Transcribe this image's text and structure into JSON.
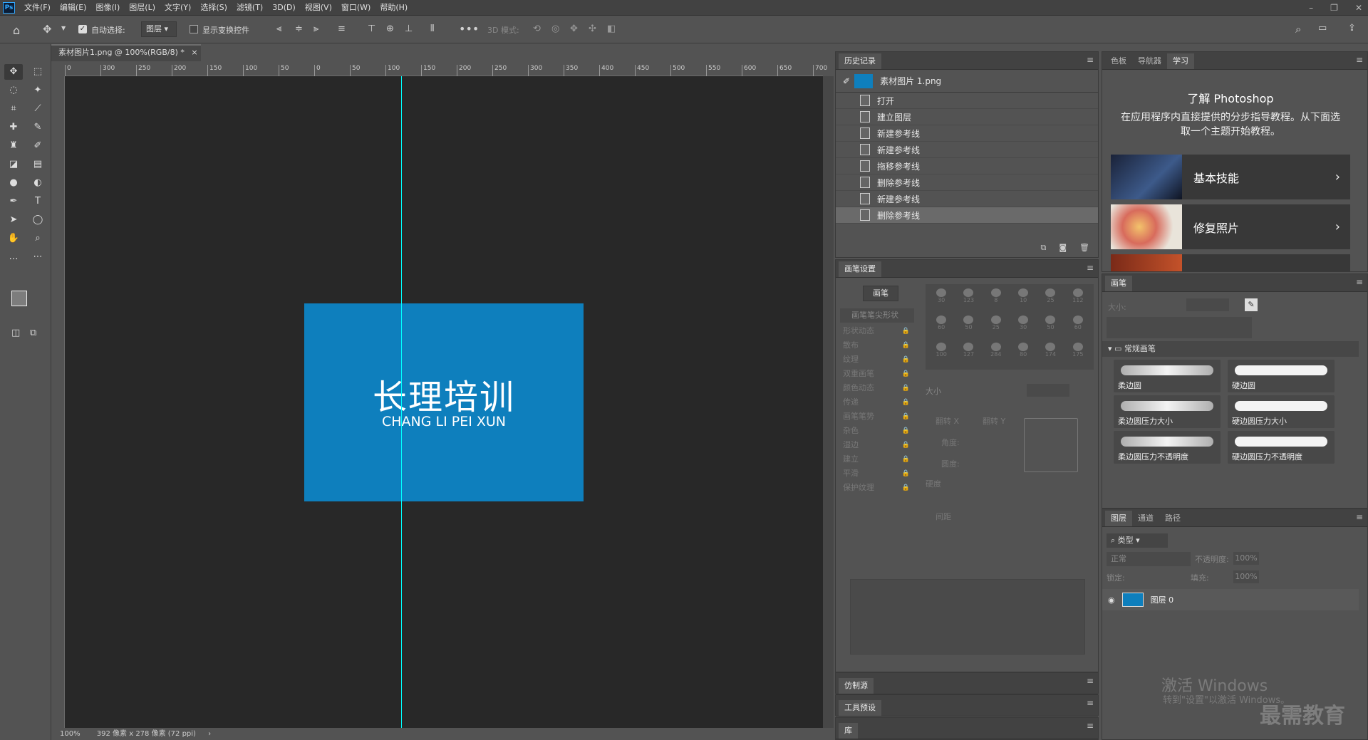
{
  "menubar": {
    "logo": "Ps",
    "items": [
      "文件(F)",
      "编辑(E)",
      "图像(I)",
      "图层(L)",
      "文字(Y)",
      "选择(S)",
      "滤镜(T)",
      "3D(D)",
      "视图(V)",
      "窗口(W)",
      "帮助(H)"
    ]
  },
  "options": {
    "auto_select_label": "自动选择:",
    "auto_select_value": "图层",
    "show_transform_label": "显示变换控件",
    "mode3d_label": "3D 模式:"
  },
  "document": {
    "tab_title": "素材图片1.png @ 100%(RGB/8) *",
    "close": "×",
    "art_title": "长理培训",
    "art_subtitle": "CHANG LI PEI XUN",
    "art_color": "#0e7fbd",
    "guide_color": "#00ffff"
  },
  "ruler": {
    "h_ticks": [
      "0",
      "300",
      "250",
      "200",
      "150",
      "100",
      "50",
      "0",
      "50",
      "100",
      "150",
      "200",
      "250",
      "300",
      "350",
      "400",
      "450",
      "500",
      "550",
      "600",
      "650",
      "700"
    ]
  },
  "status": {
    "zoom": "100%",
    "info": "392 像素 x 278 像素 (72 ppi)",
    "arrow": "›"
  },
  "history": {
    "tab": "历史记录",
    "snapshot": "素材图片 1.png",
    "items": [
      "打开",
      "建立图层",
      "新建参考线",
      "新建参考线",
      "拖移参考线",
      "删除参考线",
      "新建参考线",
      "删除参考线"
    ],
    "selected_index": 7
  },
  "brush_settings": {
    "tab": "画笔设置",
    "brush_btn": "画笔",
    "tip_shape": "画笔笔尖形状",
    "options": [
      "形状动态",
      "散布",
      "纹理",
      "双重画笔",
      "颜色动态",
      "传递",
      "画笔笔势",
      "杂色",
      "湿边",
      "建立",
      "平滑",
      "保护纹理"
    ],
    "size_label": "大小",
    "flip_x": "翻转 X",
    "flip_y": "翻转 Y",
    "angle": "角度:",
    "roundness": "圆度:",
    "hardness": "硬度",
    "spacing": "间距",
    "preset_sizes": [
      "30",
      "123",
      "8",
      "10",
      "25",
      "112",
      "60",
      "50",
      "25",
      "30",
      "50",
      "60",
      "100",
      "127",
      "284",
      "80",
      "174",
      "175"
    ]
  },
  "collapsed_panels": {
    "clone": "仿制源",
    "tool_presets": "工具预设",
    "library": "库"
  },
  "learn": {
    "tabs": [
      "色板",
      "导航器",
      "学习"
    ],
    "title": "了解 Photoshop",
    "desc": "在应用程序内直接提供的分步指导教程。从下面选取一个主题开始教程。",
    "cards": [
      "基本技能",
      "修复照片"
    ]
  },
  "brushes": {
    "tab": "画笔",
    "size_label": "大小:",
    "folder": "常规画笔",
    "items": [
      "柔边圆",
      "硬边圆",
      "柔边圆压力大小",
      "硬边圆压力大小",
      "柔边圆压力不透明度",
      "硬边圆压力不透明度"
    ]
  },
  "layers": {
    "tabs": [
      "图层",
      "通道",
      "路径"
    ],
    "filter": "类型",
    "blend": "正常",
    "opacity_label": "不透明度:",
    "opacity": "100%",
    "lock_label": "锁定:",
    "fill_label": "填充:",
    "fill": "100%",
    "layer_name": "图层 0"
  },
  "watermark": {
    "line1": "激活 Windows",
    "line2": "转到\"设置\"以激活 Windows。",
    "brand": "最需教育"
  }
}
